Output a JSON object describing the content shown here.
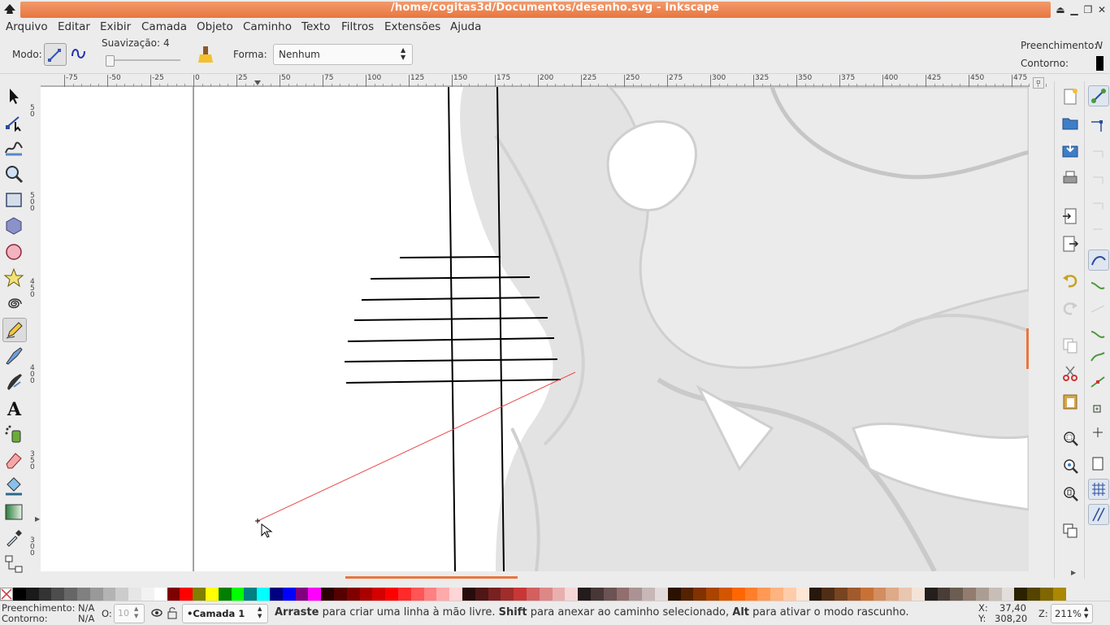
{
  "window": {
    "title": "/home/cogitas3d/Documentos/desenho.svg - Inkscape"
  },
  "menu": [
    "Arquivo",
    "Editar",
    "Exibir",
    "Camada",
    "Objeto",
    "Caminho",
    "Texto",
    "Filtros",
    "Extensões",
    "Ajuda"
  ],
  "tool_controls": {
    "mode_label": "Modo:",
    "smoothing_label": "Suavização:",
    "smoothing_value": "4",
    "shape_label": "Forma:",
    "shape_value": "Nenhum",
    "fill_label": "Preenchimento:",
    "fill_value": "N",
    "stroke_label": "Contorno:"
  },
  "hruler_labels": [
    "-75",
    "-50",
    "-25",
    "0",
    "25",
    "50",
    "75",
    "100",
    "125",
    "150",
    "175",
    "200",
    "225",
    "250",
    "275",
    "300",
    "325",
    "350",
    "375",
    "400",
    "425",
    "450",
    "475"
  ],
  "vruler_labels": [
    "5 0",
    "5 0 0",
    "4 5 0",
    "4 0 0",
    "3 5 0",
    "3 0 0"
  ],
  "toolbox_icons": [
    "selector-icon",
    "node-editor-icon",
    "tweak-icon",
    "zoom-icon",
    "rectangle-icon",
    "3d-box-icon",
    "ellipse-icon",
    "star-icon",
    "spiral-icon",
    "pencil-icon",
    "pen-icon",
    "calligraphy-icon",
    "text-icon",
    "spray-icon",
    "eraser-icon",
    "paint-bucket-icon",
    "gradient-icon",
    "dropper-icon",
    "connector-icon"
  ],
  "palette": [
    "#000000",
    "#1a1a1a",
    "#333333",
    "#4d4d4d",
    "#666666",
    "#808080",
    "#999999",
    "#b3b3b3",
    "#cccccc",
    "#e6e6e6",
    "#f2f2f2",
    "#ffffff",
    "#800000",
    "#ff0000",
    "#808000",
    "#ffff00",
    "#008000",
    "#00ff00",
    "#008080",
    "#00ffff",
    "#000080",
    "#0000ff",
    "#800080",
    "#ff00ff",
    "#2b0000",
    "#550000",
    "#800000",
    "#aa0000",
    "#d40000",
    "#ff0000",
    "#ff2a2a",
    "#ff5555",
    "#ff8080",
    "#ffaaaa",
    "#ffd5d5",
    "#280b0b",
    "#501616",
    "#782121",
    "#a02c2c",
    "#c83737",
    "#d35f5f",
    "#de8787",
    "#e9afaf",
    "#f4d7d7",
    "#241c1c",
    "#483737",
    "#6c5353",
    "#916f6f",
    "#ac9393",
    "#c8b7b7",
    "#e3dbdb",
    "#2b1100",
    "#552200",
    "#803300",
    "#aa4400",
    "#d45500",
    "#ff6600",
    "#ff7f2a",
    "#ff9955",
    "#ffb380",
    "#ffccaa",
    "#ffe6d5",
    "#28170b",
    "#502d16",
    "#784421",
    "#a05a2c",
    "#c87137",
    "#d38d5f",
    "#deaa87",
    "#e9c6af",
    "#f4e3d7",
    "#241f1c",
    "#483e37",
    "#6c5d53",
    "#917c6f",
    "#ac9d93",
    "#c8beb7",
    "#e3dedb",
    "#2b2200",
    "#554400",
    "#806600",
    "#aa8800"
  ],
  "status": {
    "fill_label": "Preenchimento:",
    "fill_value": "N/A",
    "stroke_label": "Contorno:",
    "stroke_value": "N/A",
    "opacity_label": "O:",
    "opacity_value": "10",
    "layer_value": "•Camada 1",
    "msg_bold1": "Arraste",
    "msg_1": " para criar uma linha à mão livre. ",
    "msg_bold2": "Shift",
    "msg_2": " para anexar ao caminho selecionado, ",
    "msg_bold3": "Alt",
    "msg_3": " para ativar o modo rascunho.",
    "x_label": "X:",
    "x_value": "37,40",
    "y_label": "Y:",
    "y_value": "308,20",
    "zoom_label": "Z:",
    "zoom_value": "211%"
  }
}
